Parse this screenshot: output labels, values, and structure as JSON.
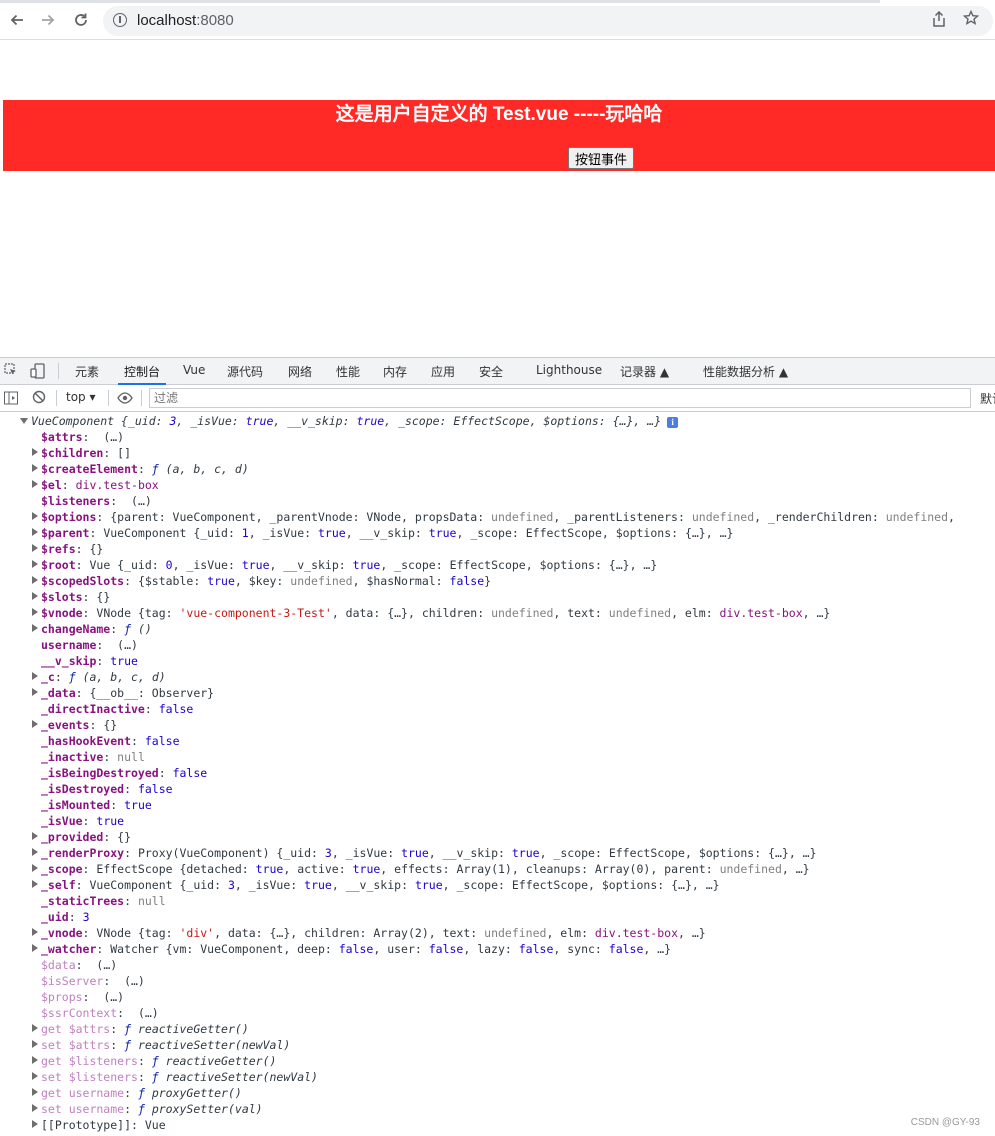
{
  "browser": {
    "url_host": "localhost",
    "url_port": ":8080",
    "back_icon": "arrow-left-icon",
    "forward_icon": "arrow-right-icon",
    "reload_icon": "reload-icon",
    "share_icon": "share-icon",
    "bookmark_icon": "star-icon"
  },
  "page": {
    "banner_title": "这是用户自定义的 Test.vue -----玩哈哈",
    "button_label": "按钮事件",
    "banner_color": "#ff2a26"
  },
  "devtools": {
    "tabs": [
      "元素",
      "控制台",
      "Vue",
      "源代码",
      "网络",
      "性能",
      "内存",
      "应用",
      "安全",
      "Lighthouse",
      "记录器 ▲",
      "性能数据分析 ▲"
    ],
    "active_tab": "控制台",
    "context": "top",
    "filter_placeholder": "过滤",
    "default_levels": "默认",
    "accent_color": "#1a73e8"
  },
  "console": {
    "lines": [
      {
        "tri": "d",
        "indent": 0,
        "html": "<span class='it'>VueComponent {_uid: <span style='color:#1c00cf'>3</span>, _isVue: <span style='color:#1c00cf'>true</span>, __v_skip: <span style='color:#1c00cf'>true</span>, _scope: EffectScope, $options: {…}, …}</span>"
      },
      {
        "tri": "",
        "indent": 1,
        "html": "<span class='key'>$attrs</span>: &nbsp;(…)"
      },
      {
        "tri": "r",
        "indent": 1,
        "html": "<span class='key'>$children</span>: []"
      },
      {
        "tri": "r",
        "indent": 1,
        "html": "<span class='key'>$createElement</span>: <span class='it'><span style='color:#0d22aa'>ƒ</span> (a, b, c, d)</span>"
      },
      {
        "tri": "r",
        "indent": 1,
        "html": "<span class='key'>$el</span>: <span style='color:#881280'>div.test-box</span>"
      },
      {
        "tri": "",
        "indent": 1,
        "html": "<span class='key'>$listeners</span>: &nbsp;(…)"
      },
      {
        "tri": "r",
        "indent": 1,
        "html": "<span class='key'>$options</span>: {parent: VueComponent, _parentVnode: VNode, propsData: <span style='color:#808080'>undefined</span>, _parentListeners: <span style='color:#808080'>undefined</span>, _renderChildren: <span style='color:#808080'>undefined</span>,"
      },
      {
        "tri": "r",
        "indent": 1,
        "html": "<span class='key'>$parent</span>: VueComponent {_uid: <span style='color:#1c00cf'>1</span>, _isVue: <span style='color:#1c00cf'>true</span>, __v_skip: <span style='color:#1c00cf'>true</span>, _scope: EffectScope, $options: {…}, …}"
      },
      {
        "tri": "r",
        "indent": 1,
        "html": "<span class='key'>$refs</span>: {}"
      },
      {
        "tri": "r",
        "indent": 1,
        "html": "<span class='key'>$root</span>: Vue {_uid: <span style='color:#1c00cf'>0</span>, _isVue: <span style='color:#1c00cf'>true</span>, __v_skip: <span style='color:#1c00cf'>true</span>, _scope: EffectScope, $options: {…}, …}"
      },
      {
        "tri": "r",
        "indent": 1,
        "html": "<span class='key'>$scopedSlots</span>: {$stable: <span style='color:#1c00cf'>true</span>, $key: <span style='color:#808080'>undefined</span>, $hasNormal: <span style='color:#1c00cf'>false</span>}"
      },
      {
        "tri": "r",
        "indent": 1,
        "html": "<span class='key'>$slots</span>: {}"
      },
      {
        "tri": "r",
        "indent": 1,
        "html": "<span class='key'>$vnode</span>: VNode {tag: <span style='color:#c41a16'>'vue-component-3-Test'</span>, data: {…}, children: <span style='color:#808080'>undefined</span>, text: <span style='color:#808080'>undefined</span>, elm: <span style='color:#881280'>div.test-box</span>, …}"
      },
      {
        "tri": "r",
        "indent": 1,
        "html": "<span class='key'>changeName</span>: <span class='it'><span style='color:#0d22aa'>ƒ</span> ()</span>"
      },
      {
        "tri": "",
        "indent": 1,
        "html": "<span class='key'>username</span>: &nbsp;(…)"
      },
      {
        "tri": "",
        "indent": 1,
        "html": "<span class='key'>__v_skip</span>: <span style='color:#1c00cf'>true</span>"
      },
      {
        "tri": "r",
        "indent": 1,
        "html": "<span class='key'>_c</span>: <span class='it'><span style='color:#0d22aa'>ƒ</span> (a, b, c, d)</span>"
      },
      {
        "tri": "r",
        "indent": 1,
        "html": "<span class='key'>_data</span>: {__ob__: Observer}"
      },
      {
        "tri": "",
        "indent": 1,
        "html": "<span class='key'>_directInactive</span>: <span style='color:#1c00cf'>false</span>"
      },
      {
        "tri": "r",
        "indent": 1,
        "html": "<span class='key'>_events</span>: {}"
      },
      {
        "tri": "",
        "indent": 1,
        "html": "<span class='key'>_hasHookEvent</span>: <span style='color:#1c00cf'>false</span>"
      },
      {
        "tri": "",
        "indent": 1,
        "html": "<span class='key'>_inactive</span>: <span style='color:#808080'>null</span>"
      },
      {
        "tri": "",
        "indent": 1,
        "html": "<span class='key'>_isBeingDestroyed</span>: <span style='color:#1c00cf'>false</span>"
      },
      {
        "tri": "",
        "indent": 1,
        "html": "<span class='key'>_isDestroyed</span>: <span style='color:#1c00cf'>false</span>"
      },
      {
        "tri": "",
        "indent": 1,
        "html": "<span class='key'>_isMounted</span>: <span style='color:#1c00cf'>true</span>"
      },
      {
        "tri": "",
        "indent": 1,
        "html": "<span class='key'>_isVue</span>: <span style='color:#1c00cf'>true</span>"
      },
      {
        "tri": "r",
        "indent": 1,
        "html": "<span class='key'>_provided</span>: {}"
      },
      {
        "tri": "r",
        "indent": 1,
        "html": "<span class='key'>_renderProxy</span>: Proxy(VueComponent) {_uid: <span style='color:#1c00cf'>3</span>, _isVue: <span style='color:#1c00cf'>true</span>, __v_skip: <span style='color:#1c00cf'>true</span>, _scope: EffectScope, $options: {…}, …}"
      },
      {
        "tri": "r",
        "indent": 1,
        "html": "<span class='key'>_scope</span>: EffectScope {detached: <span style='color:#1c00cf'>true</span>, active: <span style='color:#1c00cf'>true</span>, effects: Array(1), cleanups: Array(0), parent: <span style='color:#808080'>undefined</span>, …}"
      },
      {
        "tri": "r",
        "indent": 1,
        "html": "<span class='key'>_self</span>: VueComponent {_uid: <span style='color:#1c00cf'>3</span>, _isVue: <span style='color:#1c00cf'>true</span>, __v_skip: <span style='color:#1c00cf'>true</span>, _scope: EffectScope, $options: {…}, …}"
      },
      {
        "tri": "",
        "indent": 1,
        "html": "<span class='key'>_staticTrees</span>: <span style='color:#808080'>null</span>"
      },
      {
        "tri": "",
        "indent": 1,
        "html": "<span class='key'>_uid</span>: <span style='color:#1c00cf'>3</span>"
      },
      {
        "tri": "r",
        "indent": 1,
        "html": "<span class='key'>_vnode</span>: VNode {tag: <span style='color:#c41a16'>'div'</span>, data: {…}, children: Array(2), text: <span style='color:#808080'>undefined</span>, elm: <span style='color:#881280'>div.test-box</span>, …}"
      },
      {
        "tri": "r",
        "indent": 1,
        "html": "<span class='key'>_watcher</span>: Watcher {vm: VueComponent, deep: <span style='color:#1c00cf'>false</span>, user: <span style='color:#1c00cf'>false</span>, lazy: <span style='color:#1c00cf'>false</span>, sync: <span style='color:#1c00cf'>false</span>, …}"
      },
      {
        "tri": "",
        "indent": 1,
        "html": "<span class='keyd'>$data</span>: &nbsp;(…)"
      },
      {
        "tri": "",
        "indent": 1,
        "html": "<span class='keyd'>$isServer</span>: &nbsp;(…)"
      },
      {
        "tri": "",
        "indent": 1,
        "html": "<span class='keyd'>$props</span>: &nbsp;(…)"
      },
      {
        "tri": "",
        "indent": 1,
        "html": "<span class='keyd'>$ssrContext</span>: &nbsp;(…)"
      },
      {
        "tri": "r",
        "indent": 1,
        "html": "<span class='keyd'>get $attrs</span>: <span class='it'><span style='color:#0d22aa'>ƒ</span> reactiveGetter()</span>"
      },
      {
        "tri": "r",
        "indent": 1,
        "html": "<span class='keyd'>set $attrs</span>: <span class='it'><span style='color:#0d22aa'>ƒ</span> reactiveSetter(newVal)</span>"
      },
      {
        "tri": "r",
        "indent": 1,
        "html": "<span class='keyd'>get $listeners</span>: <span class='it'><span style='color:#0d22aa'>ƒ</span> reactiveGetter()</span>"
      },
      {
        "tri": "r",
        "indent": 1,
        "html": "<span class='keyd'>set $listeners</span>: <span class='it'><span style='color:#0d22aa'>ƒ</span> reactiveSetter(newVal)</span>"
      },
      {
        "tri": "r",
        "indent": 1,
        "html": "<span class='keyd'>get username</span>: <span class='it'><span style='color:#0d22aa'>ƒ</span> proxyGetter()</span>"
      },
      {
        "tri": "r",
        "indent": 1,
        "html": "<span class='keyd'>set username</span>: <span class='it'><span style='color:#0d22aa'>ƒ</span> proxySetter(val)</span>"
      },
      {
        "tri": "r",
        "indent": 1,
        "html": "<span class='v'>[[Prototype]]</span>: Vue"
      }
    ]
  },
  "watermark": "CSDN @GY-93"
}
